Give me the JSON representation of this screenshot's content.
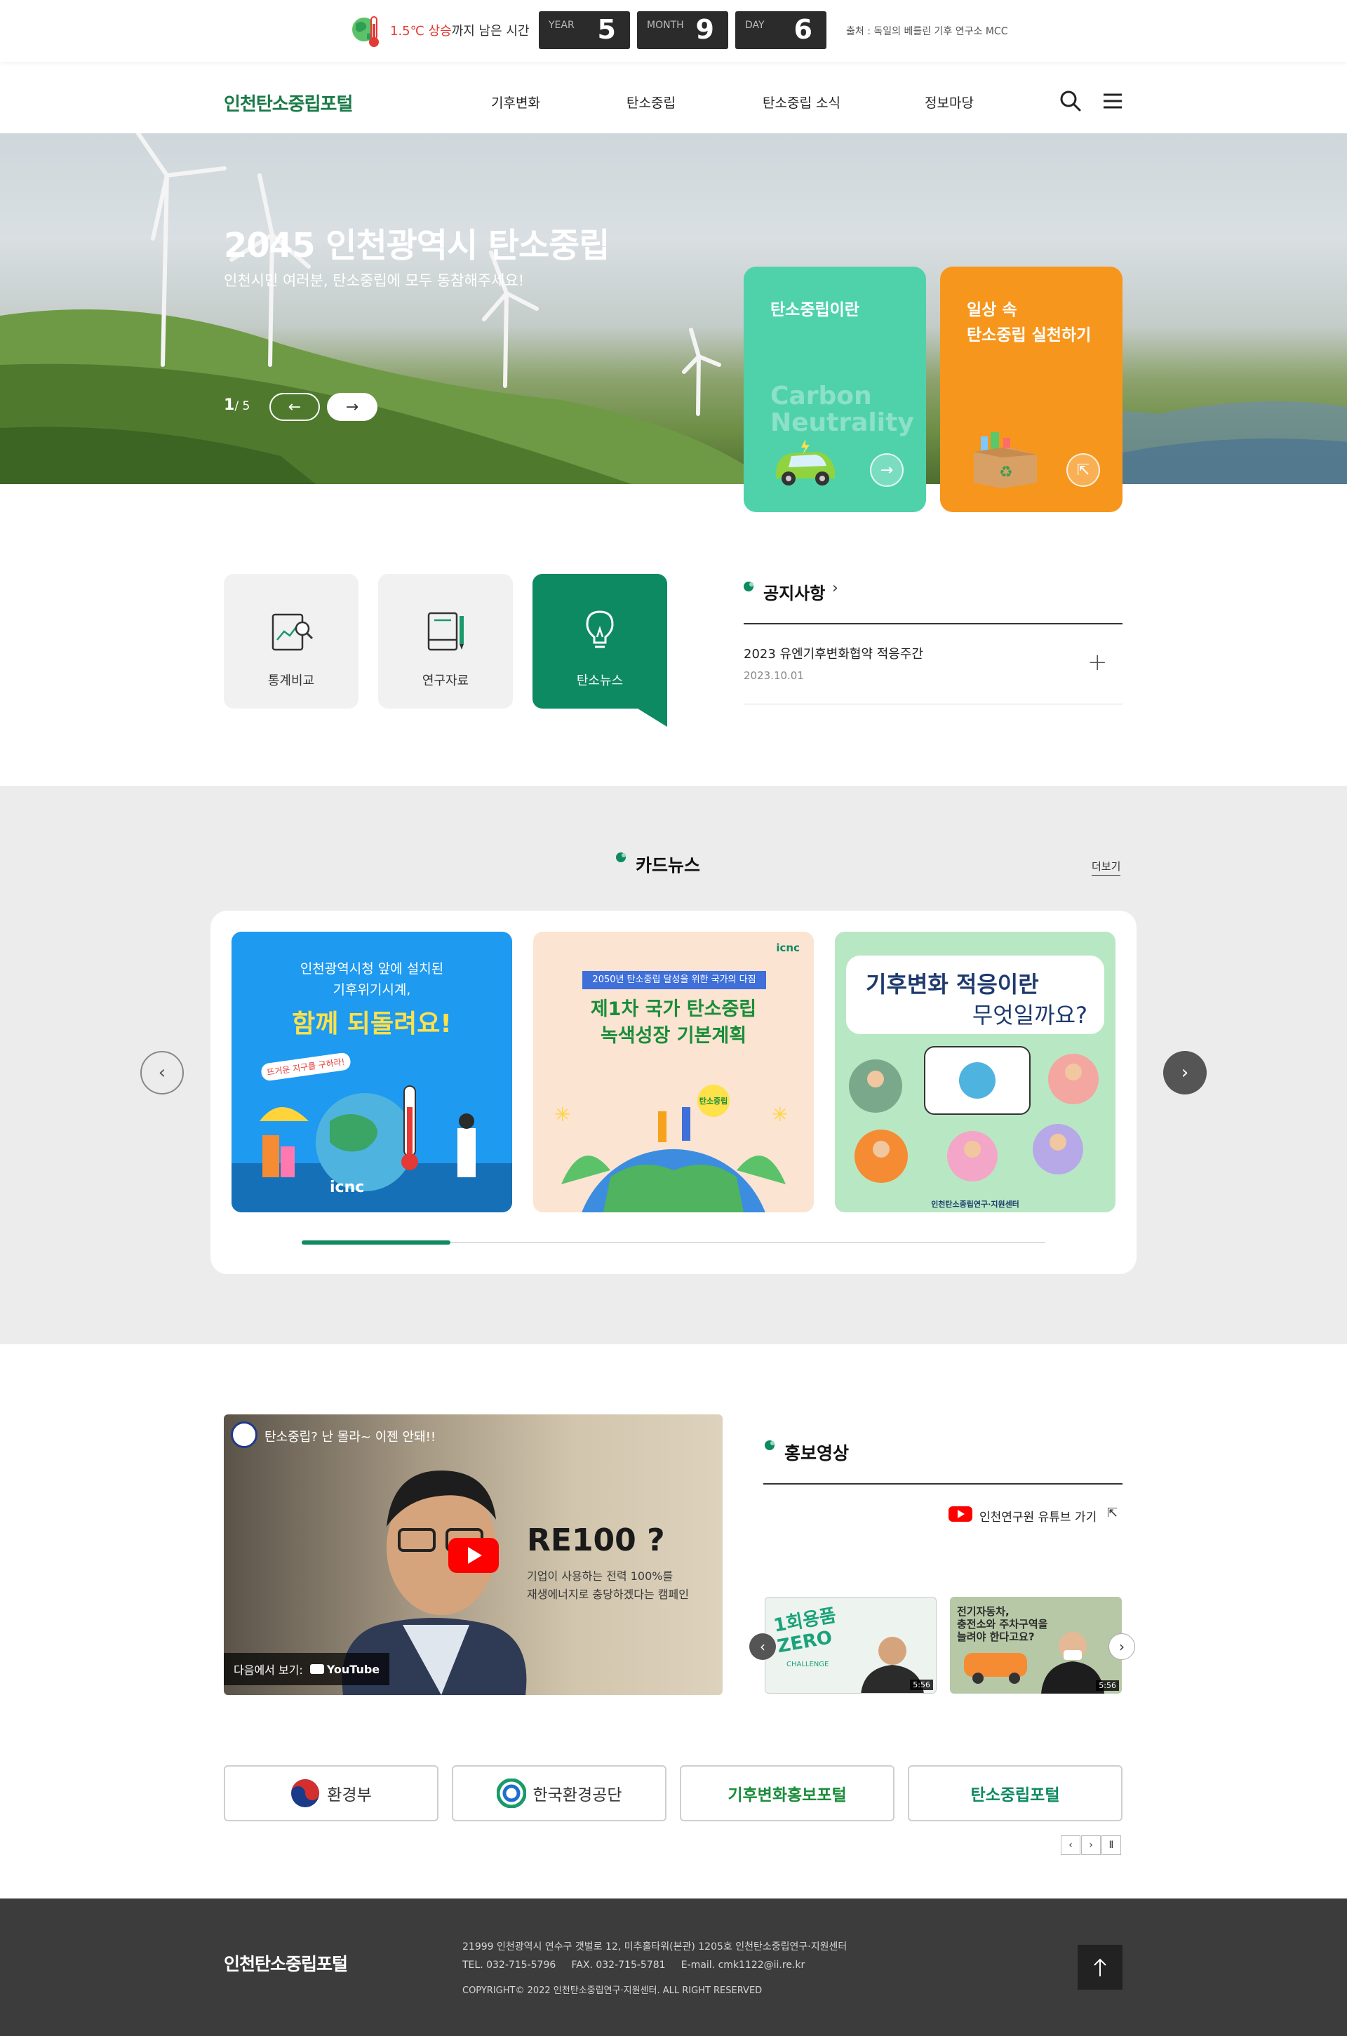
{
  "topbar": {
    "climate_prefix": "1.5℃ 상승",
    "climate_suffix": "까지 남은 시간",
    "year_label": "YEAR",
    "year_value": "5",
    "month_label": "MONTH",
    "month_value": "9",
    "day_label": "DAY",
    "day_value": "6",
    "source": "출처 : 독일의 베를린 기후 연구소 MCC"
  },
  "header": {
    "logo": "인천탄소중립포털",
    "nav": [
      "기후변화",
      "탄소중립",
      "탄소중립 소식",
      "정보마당"
    ]
  },
  "hero": {
    "title": "2045 인천광역시 탄소중립",
    "subtitle": "인천시민 여러분, 탄소중립에 모두 동참해주세요!",
    "pager_current": "1",
    "pager_total": "/ 5",
    "card1_title": "탄소중립이란",
    "card1_watermark": "Carbon Neutrality",
    "card2_title_1": "일상 속",
    "card2_title_2": "탄소중립 실천하기"
  },
  "quick_menu": [
    "통계비교",
    "연구자료",
    "탄소뉴스"
  ],
  "notice": {
    "title": "공지사항",
    "item_title": "2023 유엔기후변화협약 적응주간",
    "item_date": "2023.10.01"
  },
  "card_news": {
    "title": "카드뉴스",
    "more": "더보기",
    "card1": {
      "line1": "인천광역시청 앞에 설치된",
      "line2": "기후위기시계,",
      "headline": "함께 되돌려요!",
      "bubble": "뜨거운 지구를 구하라!",
      "logo": "icnc"
    },
    "card2": {
      "tag": "2050년 탄소중립 달성을 위한 국가의 다짐",
      "headline1": "제1차 국가 탄소중립",
      "headline2": "녹색성장 기본계획",
      "logo": "icnc",
      "badge": "탄소중립"
    },
    "card3": {
      "headline1": "기후변화 적응이란",
      "headline2": "무엇일까요?",
      "footer": "인천탄소중립연구·지원센터"
    },
    "progress": 0.2
  },
  "video": {
    "channel_title": "탄소중립? 난 몰라~ 이젠 안돼!!",
    "big_text": "RE100 ?",
    "caption1": "기업이 사용하는 전력 100%를",
    "caption2": "재생에너지로 충당하겠다는 캠페인",
    "watch_on": "다음에서 보기:",
    "youtube": "YouTube"
  },
  "promo": {
    "title": "홍보영상",
    "channel_link": "인천연구원 유튜브 가기",
    "thumb1_text1": "1회용품",
    "thumb1_text2": "ZERO",
    "thumb1_sub": "CHALLENGE",
    "thumb1_duration": "5:56",
    "thumb2_text1": "전기자동차,",
    "thumb2_text2": "충전소와 주차구역을",
    "thumb2_text3": "늘려야 한다고요?",
    "thumb2_duration": "5:56"
  },
  "partners": [
    "환경부",
    "한국환경공단",
    "기후변화홍보포털",
    "탄소중립포털"
  ],
  "footer": {
    "logo": "인천탄소중립포털",
    "address": "21999 인천광역시 연수구 갯벌로 12, 미추홀타워(본관) 1205호 인천탄소중립연구·지원센터",
    "contact": "TEL. 032-715-5796     FAX. 032-715-5781     E-mail. cmk1122@ii.re.kr",
    "copyright": "COPYRIGHT© 2022 인천탄소중립연구·지원센터. ALL RIGHT RESERVED"
  },
  "colors": {
    "brand_green": "#1a7a48",
    "mint": "#4fd2aa",
    "orange": "#f7961c",
    "teal_dark": "#0e8a63"
  }
}
